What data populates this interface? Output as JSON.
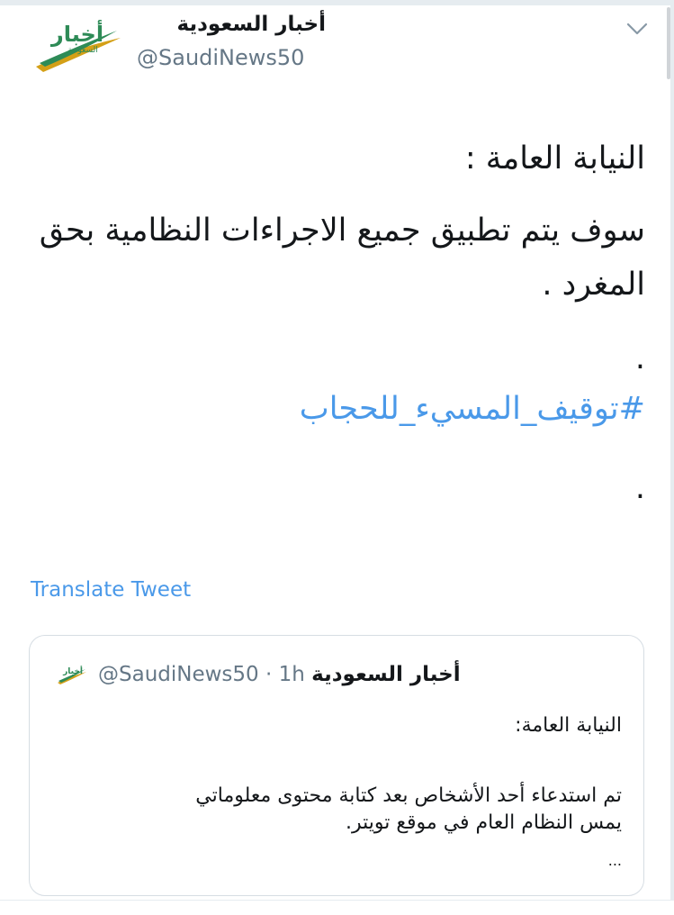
{
  "author": {
    "display_name": "أخبار السعودية",
    "handle": "@SaudiNews50",
    "logo_text": "أخبار",
    "logo_subtext": "السعودية"
  },
  "tweet": {
    "line1": "النيابة العامة :",
    "line2": "سوف يتم تطبيق جميع الاجراءات النظامية بحق المغرد .",
    "line3": ".",
    "hashtag": "#توقيف_المسيء_للحجاب",
    "line5": "."
  },
  "translate_label": "Translate Tweet",
  "quoted": {
    "display_name": "أخبار السعودية",
    "handle": "@SaudiNews50",
    "time": "· 1h",
    "line1": "النيابة العامة:",
    "line2": "تم استدعاء أحد الأشخاص بعد كتابة محتوى معلوماتي",
    "line3": "يمس النظام العام في موقع تويتر.",
    "ellipsis": "..."
  },
  "colors": {
    "link": "#4a99e9",
    "secondary_text": "#657786",
    "logo_green": "#2e8b57",
    "logo_gold": "#d4a017"
  },
  "icons": {
    "menu": "chevron-down-icon"
  }
}
